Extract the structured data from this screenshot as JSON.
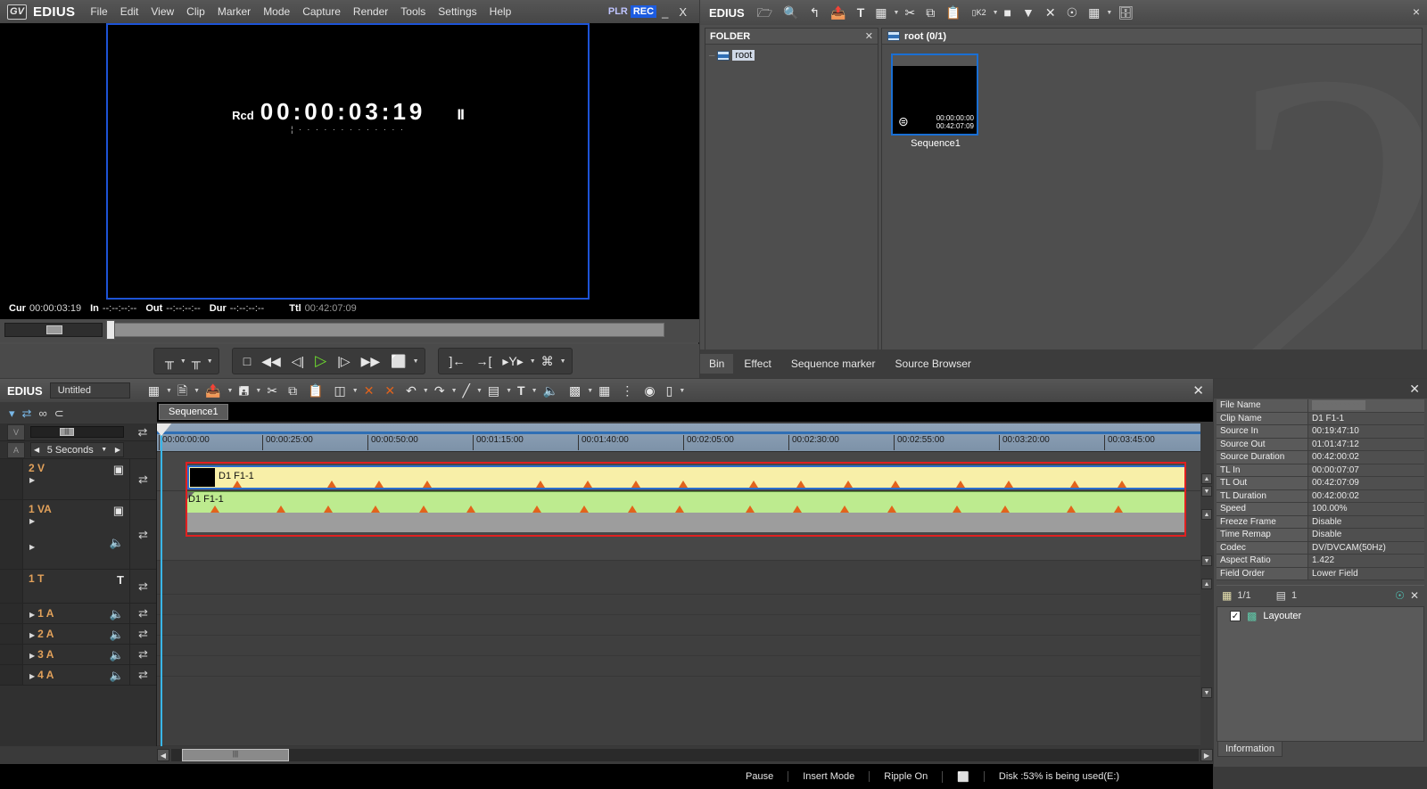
{
  "player": {
    "brand": "EDIUS",
    "logo": "GV",
    "menus": [
      "File",
      "Edit",
      "View",
      "Clip",
      "Marker",
      "Mode",
      "Capture",
      "Render",
      "Tools",
      "Settings",
      "Help"
    ],
    "mode_plr": "PLR",
    "mode_rec": "REC",
    "minimize": "_",
    "close": "X",
    "timecode": {
      "label": "Rcd",
      "value": "00:00:03:19",
      "pause_glyph": "II",
      "ticks": "¦  ·  ·  ·    ·     · ·    ·  ·    ·    · · · ·"
    },
    "status": {
      "cur_label": "Cur",
      "cur_value": "00:00:03:19",
      "in_label": "In",
      "in_value": "--:--:--:--",
      "out_label": "Out",
      "out_value": "--:--:--:--",
      "dur_label": "Dur",
      "dur_value": "--:--:--:--",
      "ttl_label": "Ttl",
      "ttl_value": "00:42:07:09"
    },
    "transport": [
      {
        "name": "set-in-point",
        "glyph": "╥"
      },
      {
        "name": "set-out-point",
        "glyph": "╥"
      },
      {
        "name": "stop",
        "glyph": "□"
      },
      {
        "name": "rewind",
        "glyph": "◀◀"
      },
      {
        "name": "previous-frame",
        "glyph": "◁|"
      },
      {
        "name": "play",
        "glyph": "▷"
      },
      {
        "name": "next-frame",
        "glyph": "|▷"
      },
      {
        "name": "fast-forward",
        "glyph": "▶▶"
      },
      {
        "name": "loop-playback",
        "glyph": "⬜"
      },
      {
        "name": "trim-in",
        "glyph": "]←"
      },
      {
        "name": "trim-out",
        "glyph": "→["
      },
      {
        "name": "add-marker",
        "glyph": "▸Y▸"
      },
      {
        "name": "export-still",
        "glyph": "⌘"
      }
    ]
  },
  "bin": {
    "brand": "EDIUS",
    "close": "×",
    "toolbar_icons": [
      "new-folder-icon",
      "search-icon",
      "up-folder-icon",
      "add-clip-icon",
      "title-icon",
      "color-bars-icon",
      "cut-icon",
      "copy-icon",
      "paste-icon",
      "k2-icon",
      "ingest-icon",
      "export-icon",
      "delete-icon",
      "properties-icon",
      "view-mode-icon",
      "print-icon"
    ],
    "folder_panel": {
      "title": "FOLDER",
      "close": "✕",
      "root_label": "root"
    },
    "clip_panel": {
      "title": "root (0/1)"
    },
    "clips": [
      {
        "name": "Sequence1",
        "tc_in": "00:00:00:00",
        "tc_dur": "00:42:07:09"
      }
    ],
    "watermark": "2",
    "tabs": [
      {
        "label": "Bin",
        "active": true
      },
      {
        "label": "Effect",
        "active": false
      },
      {
        "label": "Sequence marker",
        "active": false
      },
      {
        "label": "Source Browser",
        "active": false
      }
    ]
  },
  "timeline": {
    "brand": "EDIUS",
    "project_name": "Untitled",
    "close": "✕",
    "sequence_tab": "Sequence1",
    "zoom_scale": "5 Seconds",
    "mode_icons": [
      "mode-normal-icon",
      "mode-insert-icon",
      "mode-ripple-icon",
      "mode-group-icon"
    ],
    "toolbar_icons": [
      "project-icon",
      "new-icon",
      "open-icon",
      "save-icon",
      "cut-icon",
      "copy-icon",
      "paste-icon",
      "replace-icon",
      "delete-in-out-icon",
      "delete-gap-icon",
      "undo-icon",
      "redo-icon",
      "add-cut-icon",
      "mute-icon",
      "title-icon",
      "voiceover-icon",
      "render-icon",
      "marker-list-icon",
      "audio-mixer-icon",
      "color-correction-icon",
      "layout-icon"
    ],
    "ruler_ticks": [
      "00:00:00:00",
      "00:00:25:00",
      "00:00:50:00",
      "00:01:15:00",
      "00:01:40:00",
      "00:02:05:00",
      "00:02:30:00",
      "00:02:55:00",
      "00:03:20:00",
      "00:03:45:00"
    ],
    "tracks": [
      {
        "name": "2 V",
        "type": "video",
        "badge": "film-icon"
      },
      {
        "name": "1 VA",
        "type": "video-audio",
        "badge": "film-icon",
        "badge2": "speaker-icon"
      },
      {
        "name": "1 T",
        "type": "title",
        "badge": "T"
      },
      {
        "name": "1 A",
        "type": "audio",
        "badge": "speaker-icon"
      },
      {
        "name": "2 A",
        "type": "audio",
        "badge": "speaker-icon"
      },
      {
        "name": "3 A",
        "type": "audio",
        "badge": "speaker-icon"
      },
      {
        "name": "4 A",
        "type": "audio",
        "badge": "speaker-icon"
      }
    ],
    "clips": [
      {
        "label": "D1 F1-1",
        "kind": "video",
        "color": "#f8efa8"
      },
      {
        "label": "D1 F1-1",
        "kind": "audio",
        "color": "#bdeb8f"
      }
    ],
    "status": [
      {
        "name": "playback-state",
        "text": "Pause"
      },
      {
        "name": "edit-mode",
        "text": "Insert Mode"
      },
      {
        "name": "ripple-mode",
        "text": "Ripple On"
      },
      {
        "name": "monitor-indicator",
        "text": "⬜"
      },
      {
        "name": "disk-usage",
        "text": "Disk :53% is being used(E:)"
      }
    ]
  },
  "info": {
    "close": "✕",
    "title": "Information",
    "properties": [
      {
        "key": "File Name",
        "value": "",
        "redacted": true
      },
      {
        "key": "Clip Name",
        "value": "D1 F1-1"
      },
      {
        "key": "Source In",
        "value": "00:19:47:10"
      },
      {
        "key": "Source Out",
        "value": "01:01:47:12"
      },
      {
        "key": "Source Duration",
        "value": "00:42:00:02"
      },
      {
        "key": "TL In",
        "value": "00:00:07:07"
      },
      {
        "key": "TL Out",
        "value": "00:42:07:09"
      },
      {
        "key": "TL Duration",
        "value": "00:42:00:02"
      },
      {
        "key": "Speed",
        "value": "100.00%"
      },
      {
        "key": "Freeze Frame",
        "value": "Disable"
      },
      {
        "key": "Time Remap",
        "value": "Disable"
      },
      {
        "key": "Codec",
        "value": "DV/DVCAM(50Hz)"
      },
      {
        "key": "Aspect Ratio",
        "value": "1.422"
      },
      {
        "key": "Field Order",
        "value": "Lower Field"
      }
    ],
    "meta": {
      "video_count": "1/1",
      "audio_count": "1"
    },
    "effects": [
      {
        "label": "Layouter",
        "checked": true
      }
    ]
  }
}
